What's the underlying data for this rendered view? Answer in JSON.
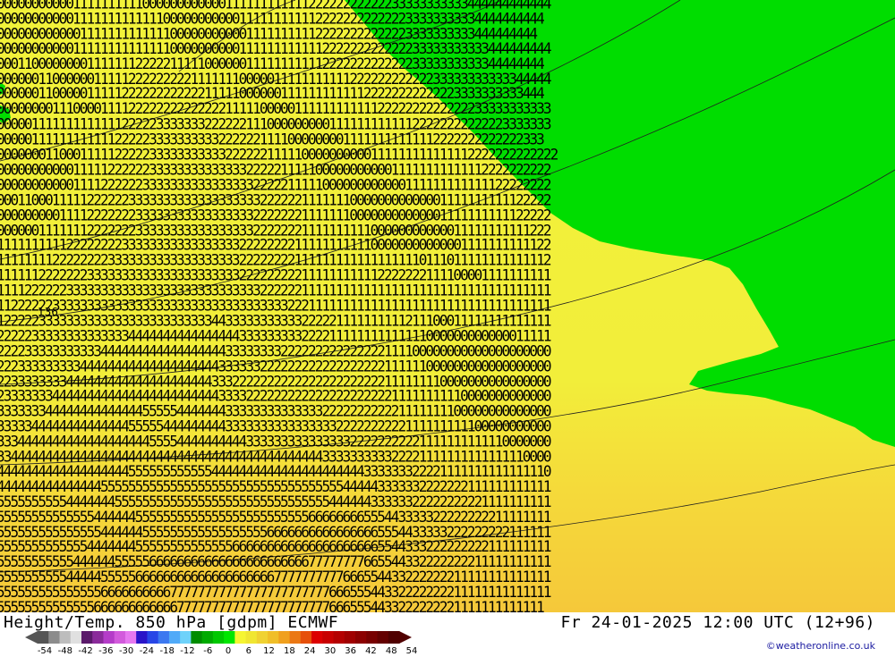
{
  "map": {
    "title": "Height/Temp. 850 hPa [gdpm] ECMWF",
    "run_time": "Fr 24-01-2025 12:00 UTC (12+96)",
    "credit": "©weatheronline.co.uk",
    "height_label": "136",
    "colors": {
      "green": "#00dd00",
      "yellow": "#f2f23a",
      "gold": "#f5d23a"
    },
    "digit_rows": [
      "00000000000111111111100000000000011111111111122222222222233333333333444444444444",
      "0000000000011111111111110000000000011111111111222222222222233333333334444444444",
      "000000000000111111111111100000000000111111111122222222222223333333333444444444",
      "00000000000111111111111110000000000111111111111222222222222233333333333444444444",
      "0001100000000111111122222111110000001111111111122222222222223333333333344444444",
      "00000011000000111112222222221111111000001111111111122222222222233333333333344444",
      "0000001100000111112222222222221111100000011111111111122222222222223333333333444",
      "00000000111000011112222222222222211111000001111111111112222222222222233333333333",
      "00000111111111111122222333333322222211100000000011111111111122222222222223333333",
      "0000011111111111122222333333333322222211110000000011111111111112222222222222333",
      "000000011000111112222233333333333222222111110000000000111111111111112222222222222",
      "00000000000111112222223333333333333322222111110000000000011111111111112222222222",
      "00000000000111122222233333333333333332222211111000000000000111111111111122222222",
      "00011000111112222223333333333333333333222222111111100000000000001111111111122222",
      "00000000011112222222333333333333333332222222111111100000000000001111111111122222",
      "00000011111112222222333333333333333332222222111111111100000000000011111111111222",
      "11111111112222222233333333333333333222222221111111111100000000000001111111111122",
      "11111111222222223333333333333333333222222221111111111111111110111011111111111112",
      "11111122222223333333333333333333333222222222111111111112222222111100001111111111",
      "11112222223333333333333333333333333333222222111111111111111111111111111111111111",
      "11222222333333333333333333333333333333333322211111111111111111111111111111111111",
      "12222233333333333333333333333334433333333333222221111111111211100011111111111111",
      "22222333333333333334444444444444444333333333222211111111111111000000000000011111",
      "22223333333333344444444444444444433333333222222222222222111100000000000000000000",
      "22233333333344444444444444444444333333222222222222222222111111000000000000000000",
      "22333333334444444444444444444443332222222222222222222222111111110000000000000000",
      "23333333444444444444444444444444333322222222222222222222211111111110000000000000",
      "33333334444444444444455555444444433333333333333222222222221111111100000000000000",
      "33333444444444444445555544444444433333333333333332222222222111111111100000000000",
      "33344444444444444444445555444444444433333333333333322222222221111111111110000000",
      "33444444444444444444444444444444444444444444444333333333322221111111111111110000",
      "44444444444444444445555555555554444444444444444444444333333322221111111111111110",
      "44444444444444455555555555555555555555555555555555444443333332222222111111111111",
      "55555555554444444555555555555555555555555555555544444433333322222222221111111111",
      "55555555555555444444555555555555555555555555566666666555443333322222222211111111",
      "55555555555555544444455555555555555555566666666666666665554433333222222222111111",
      "55555555555554444444555555555555556666666666666666666665544333222222222111111111",
      "55555555555444444555556666666666666666666666677777777665544332222222211111111111",
      "55555555554444455555666666666666666666667777777777666554433222222211111111111111",
      "55555555555555566666666667777777777777777777777766655544332222222211111111111111",
      "5555555555555566666666666677777777777777777777776665554433222222221111111111111"
    ]
  },
  "scale": {
    "tick_labels": [
      "-54",
      "-48",
      "-42",
      "-36",
      "-30",
      "-24",
      "-18",
      "-12",
      "-6",
      "0",
      "6",
      "12",
      "18",
      "24",
      "30",
      "36",
      "42",
      "48",
      "54"
    ],
    "colors": [
      "#555555",
      "#8c8c8c",
      "#bdbdbd",
      "#e0e0e0",
      "#5a1a6a",
      "#8a2a9a",
      "#b43cc8",
      "#d25adc",
      "#e678f0",
      "#2a14c8",
      "#2846e6",
      "#3c78f0",
      "#50aaf8",
      "#6ed2fa",
      "#008c00",
      "#00aa00",
      "#00c800",
      "#00e600",
      "#f5f532",
      "#f0e632",
      "#f0d232",
      "#f0be28",
      "#f0a01e",
      "#eb7814",
      "#e6500a",
      "#dc0000",
      "#c80000",
      "#b40000",
      "#a00000",
      "#8c0000",
      "#780000",
      "#640000",
      "#500000"
    ]
  }
}
